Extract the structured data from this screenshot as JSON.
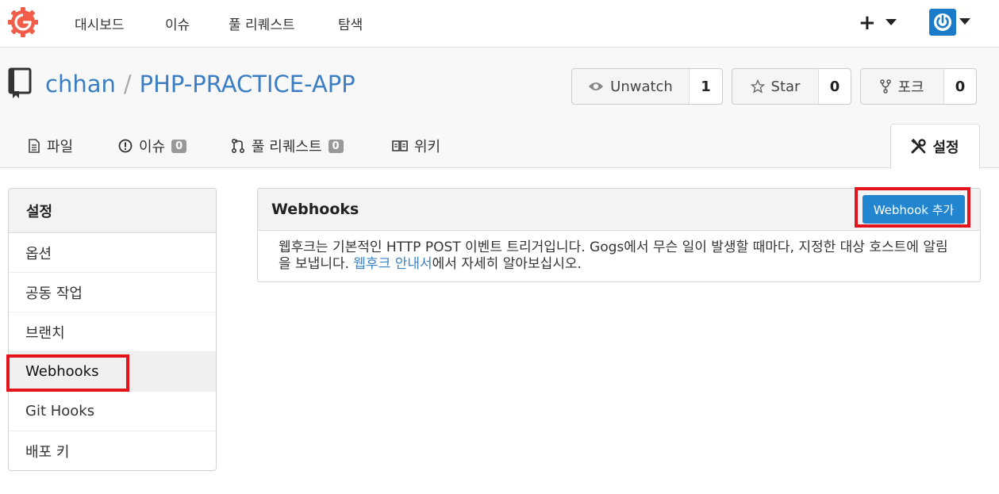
{
  "nav": {
    "items": [
      "대시보드",
      "이슈",
      "풀 리퀘스트",
      "탐색"
    ],
    "plus_label": "+"
  },
  "repo": {
    "owner": "chhan",
    "separator": "/",
    "name": "PHP-PRACTICE-APP",
    "watch": {
      "label": "Unwatch",
      "count": "1"
    },
    "star": {
      "label": "Star",
      "count": "0"
    },
    "fork": {
      "label": "포크",
      "count": "0"
    }
  },
  "tabs": {
    "files": "파일",
    "issues": {
      "label": "이슈",
      "count": "0"
    },
    "pulls": {
      "label": "풀 리퀘스트",
      "count": "0"
    },
    "wiki": "위키",
    "settings": "설정"
  },
  "sidebar": {
    "title": "설정",
    "items": [
      "옵션",
      "공동 작업",
      "브랜치",
      "Webhooks",
      "Git Hooks",
      "배포 키"
    ],
    "active_index": 3
  },
  "panel": {
    "title": "Webhooks",
    "add_button": "Webhook 추가",
    "desc_before": "웹후크는 기본적인 HTTP POST 이벤트 트리거입니다. Gogs에서 무슨 일이 발생할 때마다, 지정한 대상 호스트에 알림을 보냅니다. ",
    "desc_link": "웹후크 안내서",
    "desc_after": "에서 자세히 알아보십시오."
  },
  "colors": {
    "accent": "#2185d0",
    "link": "#3b7ec4",
    "highlight": "#e3141b",
    "logo": "#f05d48"
  }
}
